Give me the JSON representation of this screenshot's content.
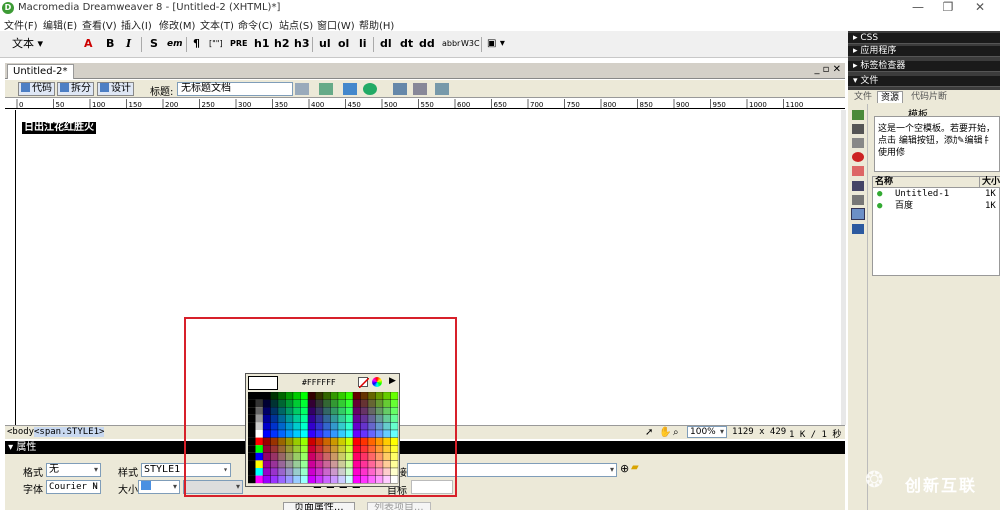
{
  "app": {
    "title": "Macromedia Dreamweaver 8 - [Untitled-2 (XHTML)*]",
    "icon": "dreamweaver-logo"
  },
  "window_controls": {
    "minimize": "—",
    "restore": "❐",
    "close": "✕"
  },
  "menu": [
    "文件(F)",
    "编辑(E)",
    "查看(V)",
    "插入(I)",
    "修改(M)",
    "文本(T)",
    "命令(C)",
    "站点(S)",
    "窗口(W)",
    "帮助(H)"
  ],
  "toolbar": {
    "category": "文本",
    "buttons": [
      "B",
      "I",
      "S",
      "em",
      "¶",
      "[\"\"]",
      "PRE",
      "h1",
      "h2",
      "h3",
      "ul",
      "ol",
      "li",
      "dl",
      "dt",
      "dd",
      "abbr",
      "W3C"
    ]
  },
  "document": {
    "tab": "Untitled-2*",
    "views": {
      "code": "代码",
      "split": "拆分",
      "design": "设计"
    },
    "title_label": "标题:",
    "title_value": "无标题文档",
    "selected_text": "日出江花红胜火"
  },
  "ruler": {
    "ticks": [
      "0",
      "50",
      "100",
      "150",
      "200",
      "250",
      "300",
      "350",
      "400",
      "450",
      "500",
      "550",
      "600",
      "650",
      "700",
      "750",
      "800",
      "850",
      "900",
      "950",
      "1000",
      "1100"
    ]
  },
  "status": {
    "tag_body": "<body>",
    "tag_span": "<span.STYLE1>",
    "zoom": "100%",
    "size": "1129 x 429",
    "download": "1 K / 1 秒"
  },
  "properties": {
    "header": "属性",
    "format_label": "格式",
    "format_value": "无",
    "style_label": "样式",
    "style_value": "STYLE1",
    "font_label": "字体",
    "font_value": "Courier N",
    "size_label": "大小",
    "link_label": "接",
    "target_label": "目标",
    "page_props_button": "页面属性...",
    "list_item_button": "列表项目..."
  },
  "panels": {
    "css": "CSS",
    "app": "应用程序",
    "tag_inspector": "标签检查器",
    "files": "文件",
    "tabs": [
      "文件",
      "资源",
      "代码片断"
    ],
    "section_title": "模板",
    "template_help": "这是一个空模板。若要开始，点击 编辑按钮，添加内容并使用修",
    "edit_button_text": "编辑",
    "col_name": "名称",
    "col_size": "大小",
    "files_list": [
      {
        "name": "Untitled-1",
        "size": "1K"
      },
      {
        "name": "百度",
        "size": "1K"
      }
    ]
  },
  "colorpicker": {
    "hex": "#FFFFFF"
  },
  "watermark": {
    "text": "创新互联"
  },
  "colors": {
    "accent_red": "#d7202a",
    "toolbar_bg": "#f0f0f0",
    "panel_bg": "#3c3c3c"
  }
}
